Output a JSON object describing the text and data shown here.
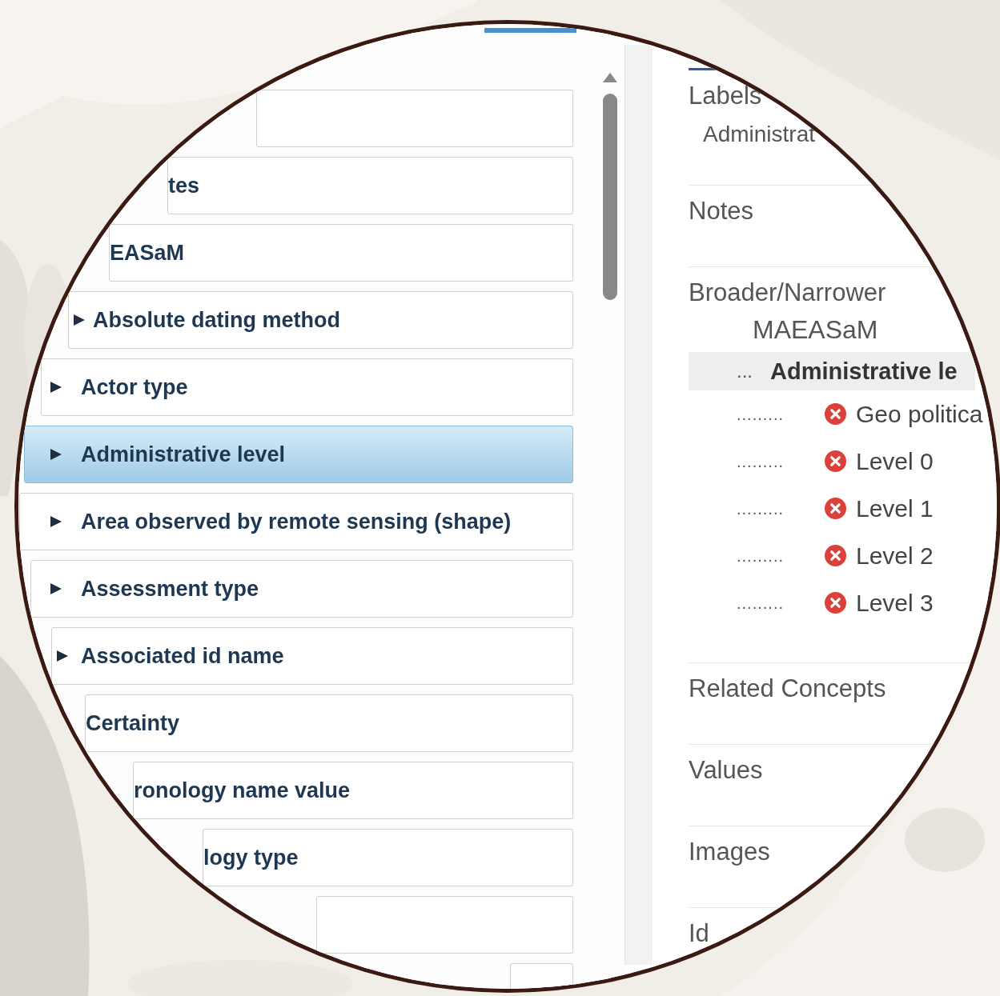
{
  "top_tab": {
    "selected": true
  },
  "list": {
    "rows": [
      {
        "label": "",
        "expandable": false,
        "selected": false
      },
      {
        "label": "tes",
        "expandable": false,
        "selected": false
      },
      {
        "label": "EASaM",
        "expandable": false,
        "selected": false
      },
      {
        "label": "Absolute dating method",
        "expandable": true,
        "selected": false
      },
      {
        "label": "Actor type",
        "expandable": true,
        "selected": false
      },
      {
        "label": "Administrative level",
        "expandable": true,
        "selected": true
      },
      {
        "label": "Area observed by remote sensing (shape)",
        "expandable": true,
        "selected": false
      },
      {
        "label": "Assessment type",
        "expandable": true,
        "selected": false
      },
      {
        "label": "Associated id name",
        "expandable": true,
        "selected": false
      },
      {
        "label": "Certainty",
        "expandable": false,
        "selected": false
      },
      {
        "label": "ronology name value",
        "expandable": false,
        "selected": false
      },
      {
        "label": "logy type",
        "expandable": false,
        "selected": false
      },
      {
        "label": "",
        "expandable": false,
        "selected": false
      },
      {
        "label": "",
        "expandable": false,
        "selected": false
      }
    ]
  },
  "details": {
    "tab": {
      "selected": true
    },
    "sections": [
      {
        "kind": "labels",
        "title": "Labels",
        "items": [
          "Administrat"
        ]
      },
      {
        "kind": "plain",
        "title": "Notes"
      },
      {
        "kind": "hierarchy",
        "title": "Broader/Narrower",
        "root": "MAEASaM",
        "current": {
          "prefix": "...",
          "label": "Administrative le",
          "selected": true
        },
        "children": [
          {
            "prefix": ".........",
            "label": "Geo politica"
          },
          {
            "prefix": ".........",
            "label": "Level 0"
          },
          {
            "prefix": ".........",
            "label": "Level 1"
          },
          {
            "prefix": ".........",
            "label": "Level 2"
          },
          {
            "prefix": ".........",
            "label": "Level 3"
          }
        ]
      },
      {
        "kind": "plain",
        "title": "Related Concepts"
      },
      {
        "kind": "plain",
        "title": "Values"
      },
      {
        "kind": "plain",
        "title": "Images"
      },
      {
        "kind": "plain",
        "title": "Id"
      }
    ]
  }
}
